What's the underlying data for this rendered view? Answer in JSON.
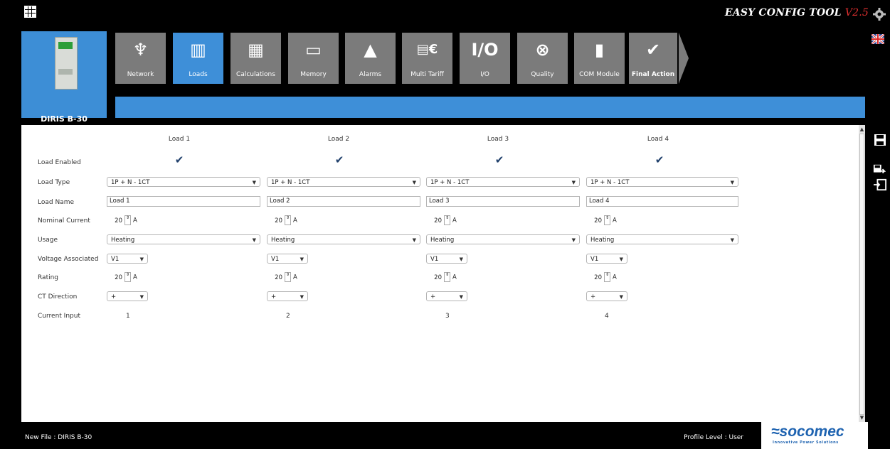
{
  "app": {
    "title_main": "EASY CONFIG TOOL ",
    "version": "V2.5"
  },
  "device": {
    "name": "DIRIS B-30"
  },
  "tabs": [
    {
      "label": "Network",
      "icon": "network-tower-icon",
      "active": false
    },
    {
      "label": "Loads",
      "icon": "loads-bar-icon",
      "active": true
    },
    {
      "label": "Calculations",
      "icon": "calculations-icon",
      "active": false
    },
    {
      "label": "Memory",
      "icon": "memory-chip-icon",
      "active": false
    },
    {
      "label": "Alarms",
      "icon": "alarm-warning-icon",
      "active": false
    },
    {
      "label": "Multi Tariff",
      "icon": "multi-tariff-icon",
      "active": false
    },
    {
      "label": "I/O",
      "icon": "io-icon",
      "active": false
    },
    {
      "label": "Quality",
      "icon": "quality-wave-icon",
      "active": false
    },
    {
      "label": "COM Module",
      "icon": "com-module-icon",
      "active": false
    },
    {
      "label": "Final Action",
      "icon": "checkmark-icon",
      "active": false
    }
  ],
  "form": {
    "labels": {
      "load_enabled": "Load Enabled",
      "load_type": "Load Type",
      "load_name": "Load Name",
      "nominal_current": "Nominal Current",
      "usage": "Usage",
      "voltage_associated": "Voltage Associated",
      "rating": "Rating",
      "ct_direction": "CT Direction",
      "current_input": "Current Input"
    },
    "loads": [
      {
        "header": "Load 1",
        "enabled": true,
        "type": "1P + N - 1CT",
        "name": "Load 1",
        "nominal": "20",
        "unit": "A",
        "usage": "Heating",
        "voltage": "V1",
        "rating": "20",
        "ct": "+",
        "input": "1"
      },
      {
        "header": "Load 2",
        "enabled": true,
        "type": "1P + N - 1CT",
        "name": "Load 2",
        "nominal": "20",
        "unit": "A",
        "usage": "Heating",
        "voltage": "V1",
        "rating": "20",
        "ct": "+",
        "input": "2"
      },
      {
        "header": "Load 3",
        "enabled": true,
        "type": "1P + N - 1CT",
        "name": "Load 3",
        "nominal": "20",
        "unit": "A",
        "usage": "Heating",
        "voltage": "V1",
        "rating": "20",
        "ct": "+",
        "input": "3"
      },
      {
        "header": "Load 4",
        "enabled": true,
        "type": "1P + N - 1CT",
        "name": "Load 4",
        "nominal": "20",
        "unit": "A",
        "usage": "Heating",
        "voltage": "V1",
        "rating": "20",
        "ct": "+",
        "input": "4"
      }
    ]
  },
  "status": {
    "file": "New File : DIRIS B-30",
    "profile": "Profile Level : User"
  },
  "logo": {
    "name": "socomec",
    "tagline": "Innovative Power Solutions"
  },
  "colors": {
    "accent": "#3e8fd8",
    "tab_gray": "#7b7b7b",
    "version_red": "#e03030"
  }
}
